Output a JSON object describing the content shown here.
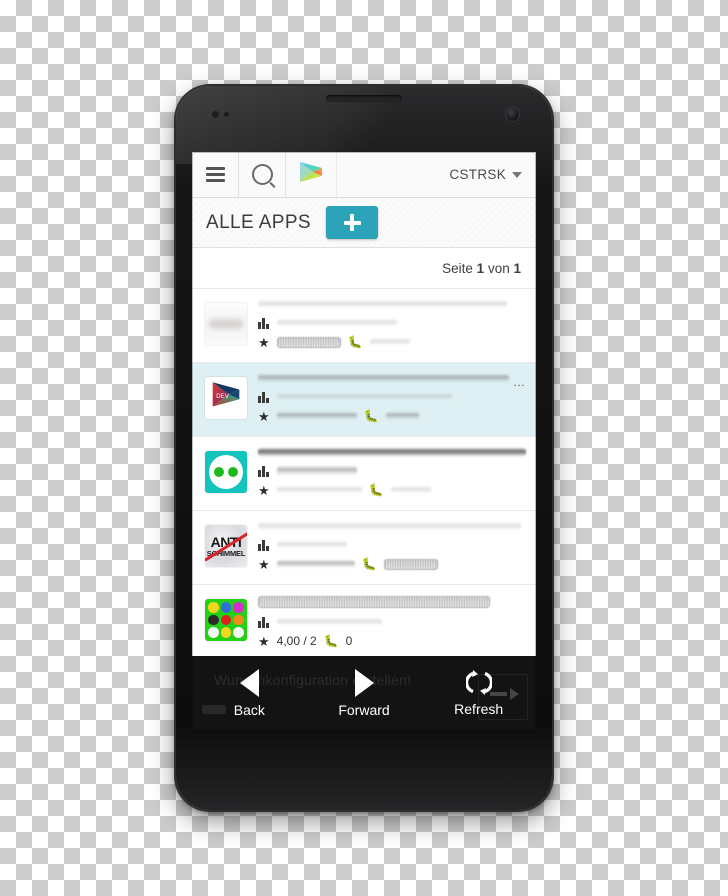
{
  "toolbar": {
    "menu_icon": "hamburger-menu-icon",
    "search_icon": "search-icon",
    "logo_icon": "google-play-logo",
    "account_label": "CSTRSK",
    "caret_icon": "chevron-down-icon"
  },
  "section": {
    "title": "ALLE APPS",
    "add_label": "+",
    "add_color": "#2ba3b8"
  },
  "pagination": {
    "prefix": "Seite",
    "current": "1",
    "middle": "von",
    "total": "1",
    "full_text": "Seite 1 von 1"
  },
  "app_list": {
    "rows": [
      {
        "icon": "blank-white-app-icon",
        "title": "",
        "installs": "",
        "rating": "",
        "crashes": "",
        "selected": false
      },
      {
        "icon": "play-store-dev-icon",
        "icon_label": "DEV",
        "title": "",
        "installs": "",
        "rating": "",
        "crashes": "",
        "selected": true,
        "overflow": "…"
      },
      {
        "icon": "teal-two-green-dots-icon",
        "title": "",
        "installs": "",
        "rating": "",
        "crashes": "",
        "selected": false
      },
      {
        "icon": "anti-schimmel-icon",
        "icon_text_top": "ANTI",
        "icon_text_bottom": "SCHIMMEL",
        "title": "",
        "installs": "",
        "rating": "",
        "crashes": "",
        "selected": false
      },
      {
        "icon": "green-colored-balls-icon",
        "title": "",
        "installs": "",
        "rating": "4,00 / 2",
        "crashes": "0",
        "selected": false
      }
    ]
  },
  "bottom_bar": {
    "ghost_text": "Wunschkonfiguration erstellen!",
    "back_label": "Back",
    "back_icon": "triangle-left-icon",
    "forward_label": "Forward",
    "forward_icon": "triangle-right-icon",
    "refresh_label": "Refresh",
    "refresh_icon": "refresh-icon",
    "background": "#131313"
  },
  "device": {
    "name": "android-smartphone",
    "earpiece": "earpiece-speaker",
    "camera": "front-camera"
  }
}
